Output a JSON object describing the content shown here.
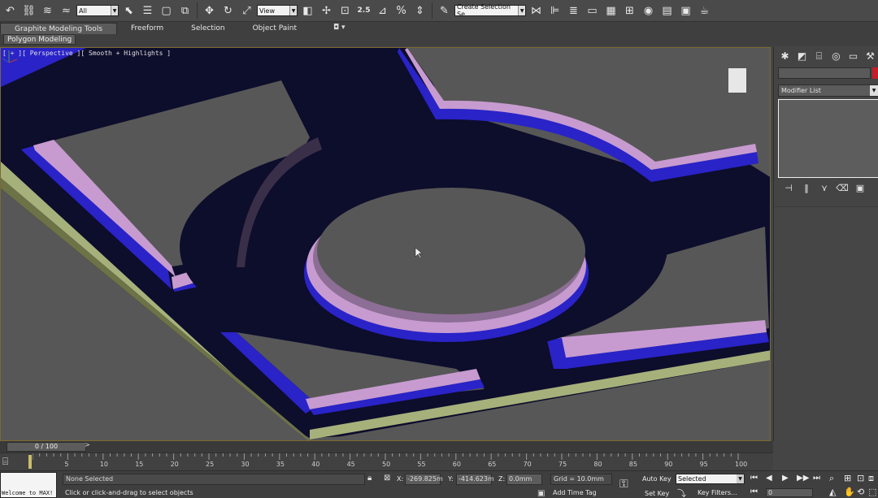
{
  "toolbar": {
    "filter_value": "All",
    "refcoord_value": "View",
    "selection_set_value": "Create Selection Se",
    "snap_label": "2.5"
  },
  "ribbon": {
    "tabs": [
      "Graphite Modeling Tools",
      "Freeform",
      "Selection",
      "Object Paint"
    ],
    "sub_tab": "Polygon Modeling",
    "pin_glyph": "◘ ▾"
  },
  "viewport": {
    "label": "[ + ][ Perspective ][ Smooth + Highlights ]"
  },
  "command_panel": {
    "modifier_list_label": "Modifier List",
    "colors": {
      "object_color": "#c81d2a"
    }
  },
  "timeline": {
    "slider_text": "0 / 100",
    "slider_next": ">",
    "ticks": [
      "5",
      "10",
      "15",
      "20",
      "25",
      "30",
      "35",
      "40",
      "45",
      "50",
      "55",
      "60",
      "65",
      "70",
      "75",
      "80",
      "85",
      "90",
      "95",
      "100"
    ]
  },
  "status": {
    "maxscript_text": "Welcome to MAX!",
    "selection_status": "None Selected",
    "prompt": "Click or click-and-drag to select objects",
    "x_label": "X:",
    "x_value": "-269.825m",
    "y_label": "Y:",
    "y_value": "-414.623m",
    "z_label": "Z:",
    "z_value": "0.0mm",
    "grid": "Grid = 10.0mm",
    "add_time_tag": "Add Time Tag",
    "auto_key": "Auto Key",
    "set_key": "Set Key",
    "selected_option": "Selected",
    "key_filters": "Key Filters...",
    "current_frame": "0"
  },
  "colors": {
    "ceiling_dark": "#0d0d2c",
    "trim_blue": "#2a23c8",
    "molding_pink": "#c79bd0",
    "molding_green": "#a6b07a",
    "background_grey": "#575757"
  }
}
